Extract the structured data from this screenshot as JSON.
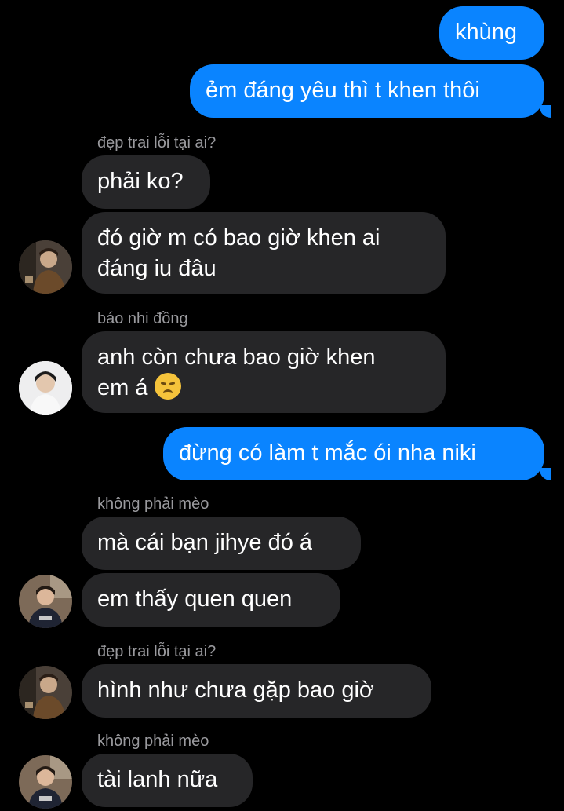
{
  "messages": {
    "m1": "khùng",
    "m2": "ẻm đáng yêu thì t khen thôi",
    "n1": "đẹp trai lỗi tại ai?",
    "m3": "phải ko?",
    "m4a": "đó giờ m có bao giờ khen ai",
    "m4b": "đáng iu đâu",
    "n2": "báo nhi đồng",
    "m5a": "anh còn chưa bao giờ khen",
    "m5b": "em á",
    "m6": "đừng có làm t mắc ói nha niki",
    "n3": "không phải mèo",
    "m7": "mà cái bạn jihye đó á",
    "m8": "em thấy quen quen",
    "n4": "đẹp trai lỗi tại ai?",
    "m9": "hình như chưa gặp bao giờ",
    "n5": "không phải mèo",
    "m10": "tài lanh nữa"
  },
  "emoji": "disappointed-face",
  "colors": {
    "outgoing": "#0a84ff",
    "incoming": "#262628",
    "background": "#000000",
    "sender": "#9a9a9e"
  }
}
